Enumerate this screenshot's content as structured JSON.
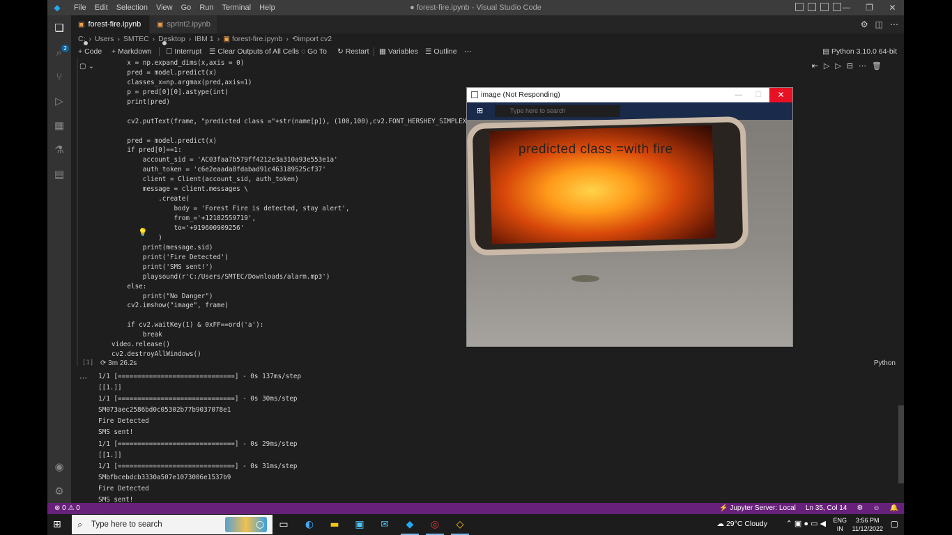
{
  "app": {
    "window_title": "● forest-fire.ipynb - Visual Studio Code",
    "menu": [
      "File",
      "Edit",
      "Selection",
      "View",
      "Go",
      "Run",
      "Terminal",
      "Help"
    ]
  },
  "tabs": [
    {
      "label": "forest-fire.ipynb",
      "dirty": true,
      "active": true
    },
    {
      "label": "sprint2.ipynb",
      "dirty": true,
      "active": false
    }
  ],
  "breadcrumb": [
    "C:",
    "Users",
    "SMTEC",
    "Desktop",
    "IBM 1",
    "forest-fire.ipynb",
    "import cv2"
  ],
  "notebook_toolbar": {
    "code": "Code",
    "markdown": "Markdown",
    "interrupt": "Interrupt",
    "clear_outputs": "Clear Outputs of All Cells",
    "go_to": "Go To",
    "restart": "Restart",
    "variables": "Variables",
    "outline": "Outline",
    "kernel": "Python 3.10.0 64-bit"
  },
  "code": [
    "    x = np.expand_dims(x,axis = 0)",
    "    pred = model.predict(x)",
    "    classes_x=np.argmax(pred,axis=1)",
    "    p = pred[0][0].astype(int)",
    "    print(pred)",
    "",
    "    cv2.putText(frame, \"predicted class =\"+str(name[p]), (100,100),cv2.FONT_HERSHEY_SIMPLEX",
    "",
    "    pred = model.predict(x)",
    "    if pred[0]==1:",
    "        account_sid = 'AC03faa7b579ff4212e3a310a93e553e1a'",
    "        auth_token = 'c6e2eaada8fdabad91c463189525cf37'",
    "        client = Client(account_sid, auth_token)",
    "        message = client.messages \\",
    "            .create(",
    "                body = 'Forest Fire is detected, stay alert',",
    "                from_='+12182559719',",
    "                to='+919600909256'",
    "            )",
    "        print(message.sid)",
    "        print('Fire Detected')",
    "        print('SMS sent!')",
    "        playsound(r'C:/Users/SMTEC/Downloads/alarm.mp3')",
    "    else:",
    "        print(\"No Danger\")",
    "    cv2.imshow(\"image\", frame)",
    "",
    "    if cv2.waitKey(1) & 0xFF==ord('a'):",
    "        break",
    "video.release()",
    "cv2.destroyAllWindows()"
  ],
  "cell_status": {
    "index": "[1]",
    "time": "3m 26.2s",
    "language": "Python"
  },
  "output": [
    "1/1 [==============================] - 0s 137ms/step",
    "[[1.]]",
    "1/1 [==============================] - 0s 30ms/step",
    "SM073aec2586bd0c05302b77b9037078e1",
    "Fire Detected",
    "SMS sent!",
    "1/1 [==============================] - 0s 29ms/step",
    "[[1.]]",
    "1/1 [==============================] - 0s 31ms/step",
    "SMbfbcebdcb3330a507e1073006e1537b9",
    "Fire Detected",
    "SMS sent!"
  ],
  "statusbar": {
    "problems": "⊗ 0 ⚠ 0",
    "jupyter": "Jupyter Server: Local",
    "position": "Ln 35, Col 14"
  },
  "cv_window": {
    "title": "image (Not Responding)",
    "overlay_text": "predicted class =with fire",
    "search_placeholder": "Type here to search"
  },
  "taskbar": {
    "search_placeholder": "Type here to search",
    "weather": "29°C  Cloudy",
    "lang_top": "ENG",
    "lang_bottom": "IN",
    "time": "3:56 PM",
    "date": "11/12/2022"
  },
  "colors": {
    "accent_status": "#68217a",
    "editor_bg": "#1e1e1e",
    "close_red": "#e81123"
  }
}
